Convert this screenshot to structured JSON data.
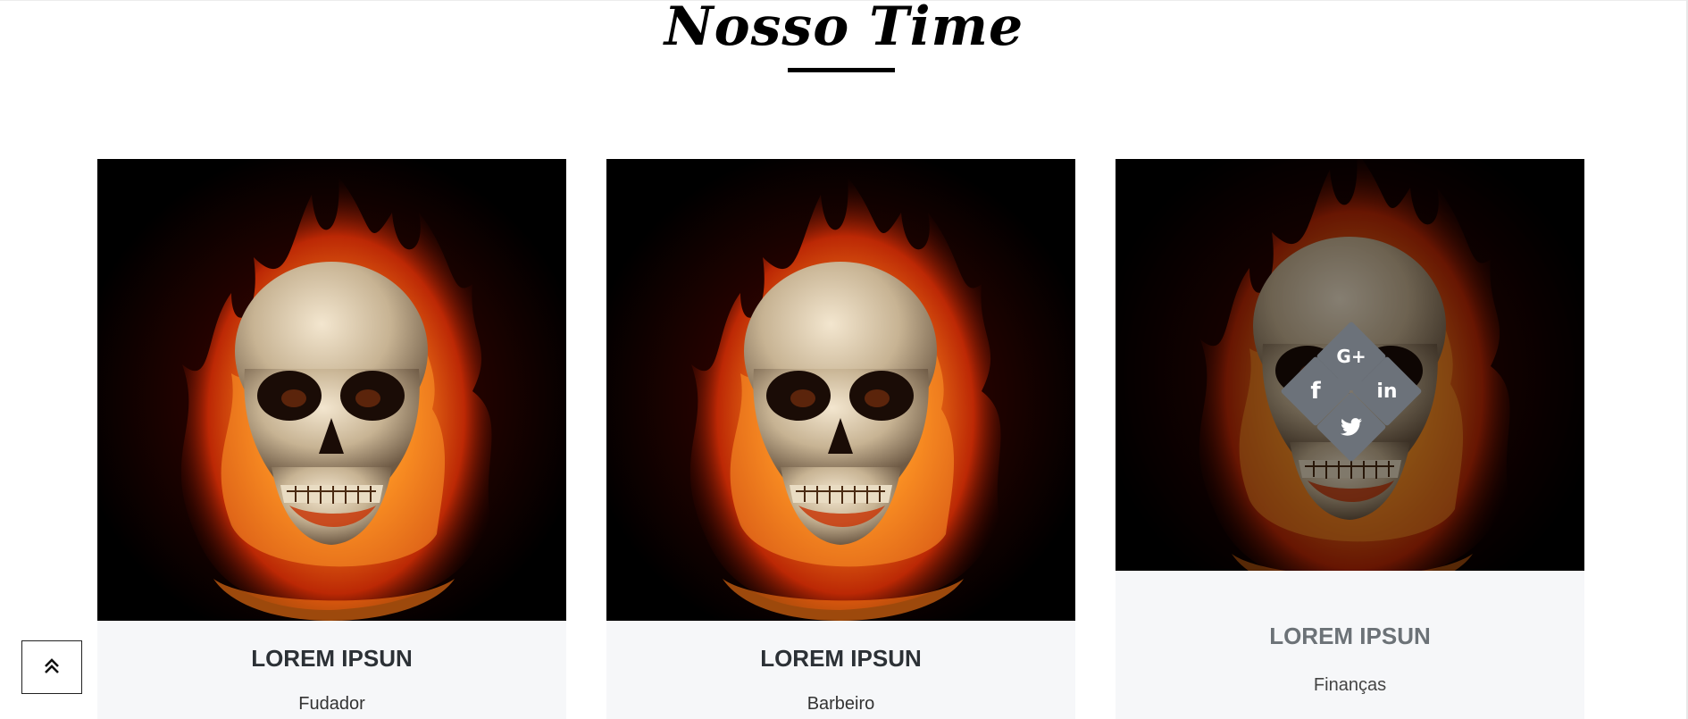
{
  "section": {
    "title": "Nosso Time"
  },
  "team": [
    {
      "name": "LOREM IPSUN",
      "role": "Fudador"
    },
    {
      "name": "LOREM IPSUN",
      "role": "Barbeiro"
    },
    {
      "name": "LOREM IPSUN",
      "role": "Finanças"
    }
  ],
  "social_icons": [
    {
      "icon": "google-plus-icon",
      "glyph": "G+"
    },
    {
      "icon": "facebook-icon",
      "glyph": "f"
    },
    {
      "icon": "linkedin-icon",
      "glyph": "in"
    },
    {
      "icon": "twitter-icon",
      "glyph": "bird"
    }
  ],
  "back_to_top": {
    "icon": "double-chevron-up-icon"
  },
  "colors": {
    "caption_bg": "#f6f7f9",
    "social_diamond": "#6c727a",
    "title": "#000000",
    "name_text": "#2c3136"
  }
}
